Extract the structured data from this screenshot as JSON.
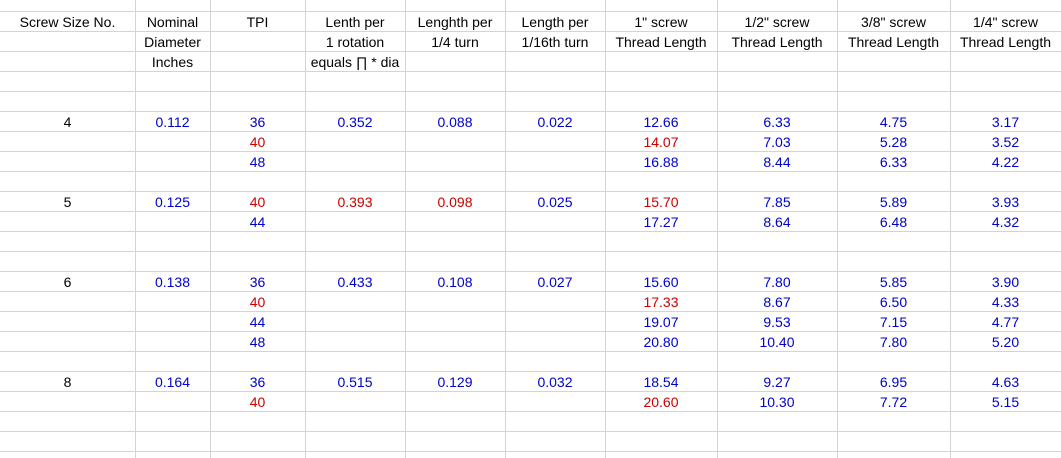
{
  "headers": [
    [
      "Screw Size No.",
      "Nominal",
      "TPI",
      "Lenth per",
      "Lenghth per",
      "Length per",
      "1\" screw",
      "1/2\" screw",
      "3/8\" screw",
      "1/4\" screw"
    ],
    [
      "",
      "Diameter",
      "",
      "1 rotation",
      "1/4 turn",
      "1/16th turn",
      "Thread Length",
      "Thread Length",
      "Thread Length",
      "Thread Length"
    ],
    [
      "",
      "Inches",
      "",
      "equals ∏ * dia",
      "",
      "",
      "",
      "",
      "",
      ""
    ]
  ],
  "groups": [
    {
      "size": "4",
      "diameter": "0.112",
      "rotation": {
        "v": "0.352",
        "c": "blue"
      },
      "quarter": {
        "v": "0.088",
        "c": "blue"
      },
      "sixteenth": {
        "v": "0.022",
        "c": "blue"
      },
      "rows": [
        {
          "tpi": "36",
          "c": "blue",
          "t1": {
            "v": "12.66",
            "c": "blue"
          },
          "t12": "6.33",
          "t38": "4.75",
          "t14": "3.17"
        },
        {
          "tpi": "40",
          "c": "red",
          "t1": {
            "v": "14.07",
            "c": "red"
          },
          "t12": "7.03",
          "t38": "5.28",
          "t14": "3.52"
        },
        {
          "tpi": "48",
          "c": "blue",
          "t1": {
            "v": "16.88",
            "c": "blue"
          },
          "t12": "8.44",
          "t38": "6.33",
          "t14": "4.22"
        }
      ]
    },
    {
      "size": "5",
      "diameter": "0.125",
      "rotation": {
        "v": "0.393",
        "c": "red"
      },
      "quarter": {
        "v": "0.098",
        "c": "red"
      },
      "sixteenth": {
        "v": "0.025",
        "c": "blue"
      },
      "rows": [
        {
          "tpi": "40",
          "c": "red",
          "t1": {
            "v": "15.70",
            "c": "red"
          },
          "t12": "7.85",
          "t38": "5.89",
          "t14": "3.93"
        },
        {
          "tpi": "44",
          "c": "blue",
          "t1": {
            "v": "17.27",
            "c": "blue"
          },
          "t12": "8.64",
          "t38": "6.48",
          "t14": "4.32"
        }
      ]
    },
    {
      "size": "6",
      "diameter": "0.138",
      "rotation": {
        "v": "0.433",
        "c": "blue"
      },
      "quarter": {
        "v": "0.108",
        "c": "blue"
      },
      "sixteenth": {
        "v": "0.027",
        "c": "blue"
      },
      "rows": [
        {
          "tpi": "36",
          "c": "blue",
          "t1": {
            "v": "15.60",
            "c": "blue"
          },
          "t12": "7.80",
          "t38": "5.85",
          "t14": "3.90"
        },
        {
          "tpi": "40",
          "c": "red",
          "t1": {
            "v": "17.33",
            "c": "red"
          },
          "t12": "8.67",
          "t38": "6.50",
          "t14": "4.33"
        },
        {
          "tpi": "44",
          "c": "blue",
          "t1": {
            "v": "19.07",
            "c": "blue"
          },
          "t12": "9.53",
          "t38": "7.15",
          "t14": "4.77"
        },
        {
          "tpi": "48",
          "c": "blue",
          "t1": {
            "v": "20.80",
            "c": "blue"
          },
          "t12": "10.40",
          "t38": "7.80",
          "t14": "5.20"
        }
      ]
    },
    {
      "size": "8",
      "diameter": "0.164",
      "rotation": {
        "v": "0.515",
        "c": "blue"
      },
      "quarter": {
        "v": "0.129",
        "c": "blue"
      },
      "sixteenth": {
        "v": "0.032",
        "c": "blue"
      },
      "rows": [
        {
          "tpi": "36",
          "c": "blue",
          "t1": {
            "v": "18.54",
            "c": "blue"
          },
          "t12": "9.27",
          "t38": "6.95",
          "t14": "4.63"
        },
        {
          "tpi": "40",
          "c": "red",
          "t1": {
            "v": "20.60",
            "c": "red"
          },
          "t12": "10.30",
          "t38": "7.72",
          "t14": "5.15"
        }
      ]
    }
  ],
  "colors": {
    "blue": "#0000cc",
    "red": "#cc0000",
    "grid": "#d4d4d4"
  }
}
